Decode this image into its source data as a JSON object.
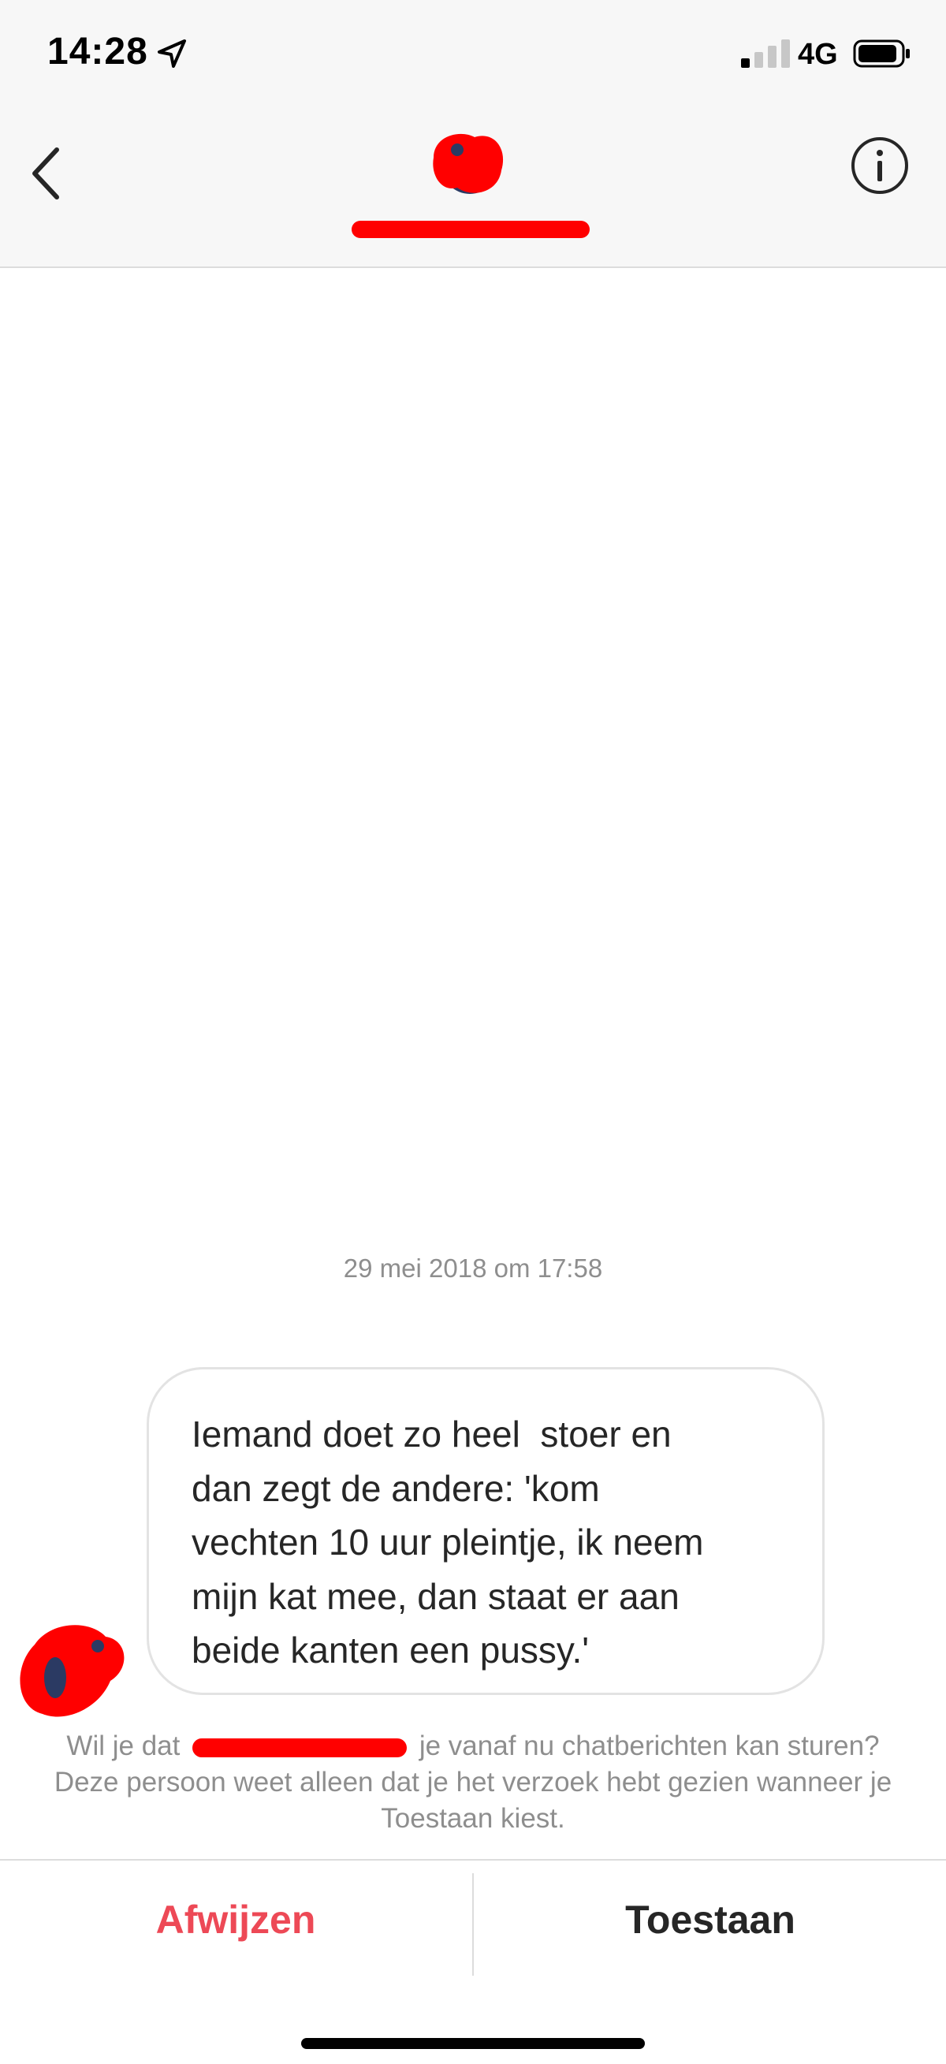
{
  "status_bar": {
    "time": "14:28",
    "network": "4G",
    "icons": [
      "location-arrow-icon",
      "cellular-signal-icon",
      "battery-icon"
    ]
  },
  "header": {
    "username": "",
    "icons": [
      "chevron-left-icon",
      "info-icon"
    ]
  },
  "conversation": {
    "timestamp": "29 mei 2018 om 17:58",
    "message": "Iemand doet zo heel  stoer en\ndan zegt de andere: 'kom\nvechten 10 uur pleintje, ik neem\nmijn kat mee, dan staat er aan\nbeide kanten een pussy.'"
  },
  "request": {
    "before": "Wil je dat",
    "after": "je vanaf nu chatberichten kan sturen? Deze persoon weet alleen dat je het verzoek hebt gezien wanneer je Toestaan kiest."
  },
  "actions": {
    "reject_label": "Afwijzen",
    "accept_label": "Toestaan"
  },
  "colors": {
    "reject": "#ed4956",
    "redaction": "#ff0000",
    "secondary_text": "#8e8e8e"
  }
}
